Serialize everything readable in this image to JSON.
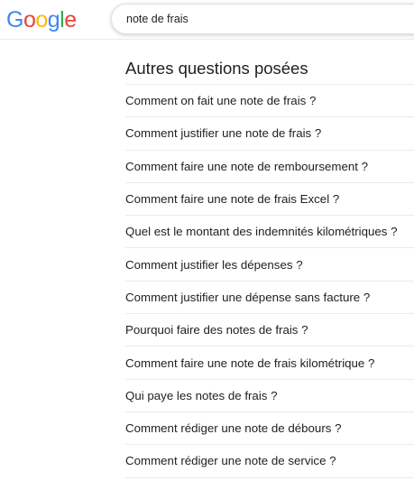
{
  "logo": {
    "letters": [
      {
        "ch": "G",
        "color": "#4285F4"
      },
      {
        "ch": "o",
        "color": "#EA4335"
      },
      {
        "ch": "o",
        "color": "#FBBC05"
      },
      {
        "ch": "g",
        "color": "#4285F4"
      },
      {
        "ch": "l",
        "color": "#34A853"
      },
      {
        "ch": "e",
        "color": "#EA4335"
      }
    ]
  },
  "search": {
    "value": "note de frais"
  },
  "paa": {
    "title": "Autres questions posées",
    "questions": [
      "Comment on fait une note de frais ?",
      "Comment justifier une note de frais ?",
      "Comment faire une note de remboursement ?",
      "Comment faire une note de frais Excel ?",
      "Quel est le montant des indemnités kilométriques ?",
      "Comment justifier les dépenses ?",
      "Comment justifier une dépense sans facture ?",
      "Pourquoi faire des notes de frais ?",
      "Comment faire une note de frais kilométrique ?",
      "Qui paye les notes de frais ?",
      "Comment rédiger une note de débours ?",
      "Comment rédiger une note de service ?"
    ]
  }
}
